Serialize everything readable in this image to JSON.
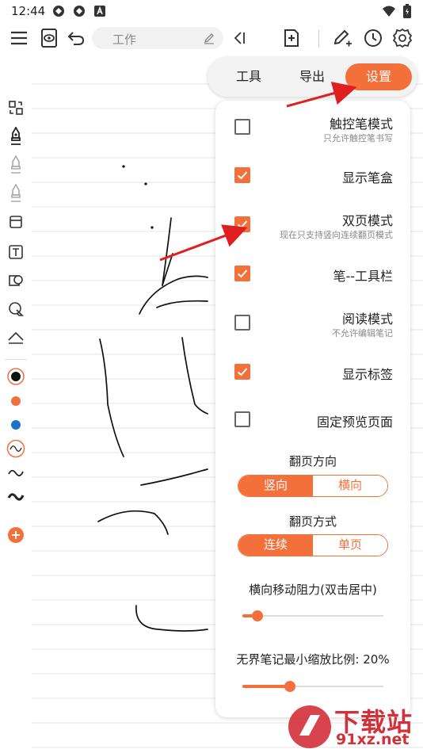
{
  "status_bar": {
    "time": "12:44"
  },
  "toolbar": {
    "title": "工作"
  },
  "panel": {
    "tabs": [
      {
        "label": "工具",
        "active": false
      },
      {
        "label": "导出",
        "active": false
      },
      {
        "label": "设置",
        "active": true
      }
    ],
    "options": [
      {
        "label": "触控笔模式",
        "hint": "只允许触控笔书写",
        "checked": false
      },
      {
        "label": "显示笔盒",
        "hint": "",
        "checked": true
      },
      {
        "label": "双页模式",
        "hint": "现在只支持竖向连续翻页模式",
        "checked": true
      },
      {
        "label": "笔--工具栏",
        "hint": "",
        "checked": true
      },
      {
        "label": "阅读模式",
        "hint": "不允许编辑笔记",
        "checked": false
      },
      {
        "label": "显示标签",
        "hint": "",
        "checked": true
      },
      {
        "label": "固定预览页面",
        "hint": "",
        "checked": false
      }
    ],
    "page_direction": {
      "title": "翻页方向",
      "options": [
        "竖向",
        "横向"
      ],
      "selected": "竖向"
    },
    "page_mode": {
      "title": "翻页方式",
      "options": [
        "连续",
        "单页"
      ],
      "selected": "连续"
    },
    "horizontal_resistance": {
      "title": "横向移动阻力(双击居中)",
      "value": 0.1
    },
    "min_zoom": {
      "title": "无界笔记最小缩放比例: 20%",
      "value": 0.34
    }
  },
  "rail_colors": {
    "black": "#111111",
    "orange": "#f4703a",
    "blue": "#1a73c9"
  },
  "accent_color": "#f4703a",
  "watermark": {
    "text1": "下载站",
    "text2": "91xz.net"
  }
}
